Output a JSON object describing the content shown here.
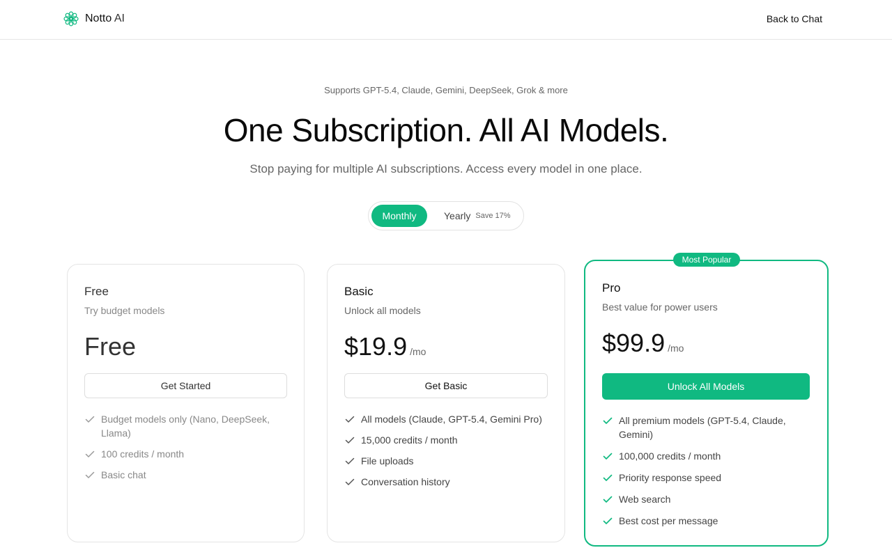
{
  "brand": {
    "name": "Notto",
    "suffix": " AI",
    "logo_icon": "flower-logo-icon",
    "accent": "#10b981"
  },
  "nav": {
    "back_label": "Back to Chat"
  },
  "hero": {
    "eyebrow": "Supports GPT-5.4, Claude, Gemini, DeepSeek, Grok & more",
    "title": "One Subscription. All AI Models.",
    "subtitle": "Stop paying for multiple AI subscriptions. Access every model in one place."
  },
  "billing_toggle": {
    "monthly_label": "Monthly",
    "yearly_label": "Yearly",
    "yearly_badge": "Save 17%",
    "selected": "Monthly"
  },
  "plans": [
    {
      "name": "Free",
      "description": "Try budget models",
      "price": "Free",
      "period": "",
      "cta": "Get Started",
      "features": [
        "Budget models only (Nano, DeepSeek, Llama)",
        "100 credits / month",
        "Basic chat"
      ]
    },
    {
      "name": "Basic",
      "description": "Unlock all models",
      "price": "$19.9",
      "period": "/mo",
      "cta": "Get Basic",
      "features": [
        "All models (Claude, GPT-5.4, Gemini Pro)",
        "15,000 credits / month",
        "File uploads",
        "Conversation history"
      ]
    },
    {
      "name": "Pro",
      "description": "Best value for power users",
      "price": "$99.9",
      "period": "/mo",
      "cta": "Unlock All Models",
      "badge": "Most Popular",
      "features": [
        "All premium models (GPT-5.4, Claude, Gemini)",
        "100,000 credits / month",
        "Priority response speed",
        "Web search",
        "Best cost per message"
      ]
    }
  ],
  "icons": {
    "check": "check-icon"
  },
  "colors": {
    "check_muted": "#9a9a9a",
    "check_basic": "#555555",
    "check_pro": "#10b981"
  }
}
